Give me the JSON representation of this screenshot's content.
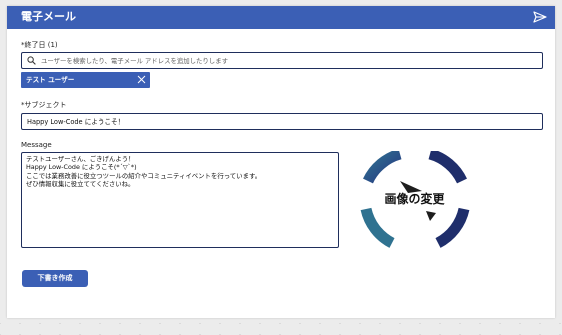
{
  "header": {
    "title": "電子メール",
    "send_icon": "send-icon",
    "background_color": "#3b5fb5"
  },
  "recipient": {
    "label": "*終了日 (1)",
    "search_placeholder": "ユーザーを検索したり、電子メール アドレスを追加したりします",
    "search_icon": "search-icon",
    "selected_users": [
      {
        "name": "テスト ユーザー",
        "remove_icon": "close-icon"
      }
    ]
  },
  "subject": {
    "label": "*サブジェクト",
    "value": "Happy Low-Code にようこそ！"
  },
  "message": {
    "label": "Message",
    "value": "テストユーザーさん、ごきげんよう！\nHappy Low-Code にようこそ(*´▽`*)\nここでは業務改善に役立つツールの紹介やコミュニティイベントを行っています。\nぜひ情報収集に役立ててくださいね。"
  },
  "image": {
    "label": "画像の変更",
    "placeholder_icon": "image-placeholder-icon",
    "colors": [
      "#1f2e6b",
      "#2f7290"
    ]
  },
  "actions": {
    "draft_label": "下書き作成"
  }
}
